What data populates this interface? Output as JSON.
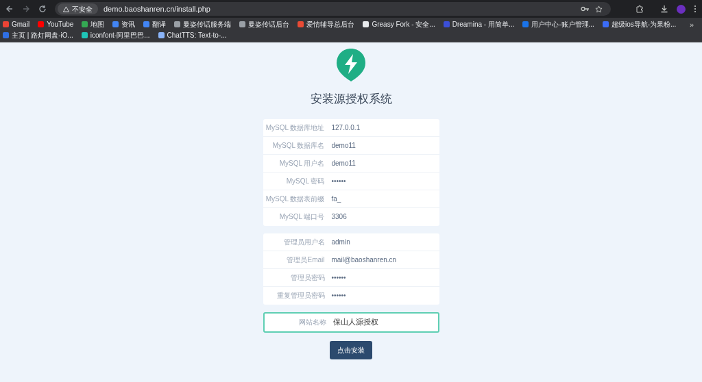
{
  "browser": {
    "security_label": "不安全",
    "url": "demo.baoshanren.cn/install.php",
    "overflow": "»",
    "bookmarks": [
      {
        "label": "Gmail",
        "color": "#ea4335"
      },
      {
        "label": "YouTube",
        "color": "#ff0000"
      },
      {
        "label": "地图",
        "color": "#34a853"
      },
      {
        "label": "资讯",
        "color": "#4285f4"
      },
      {
        "label": "翻译",
        "color": "#4285f4"
      },
      {
        "label": "曼姿传话服务端",
        "color": "#9aa0a6"
      },
      {
        "label": "曼姿传话后台",
        "color": "#9aa0a6"
      },
      {
        "label": "爱情辅导总后台",
        "color": "#e94b35"
      },
      {
        "label": "Greasy Fork - 安全...",
        "color": "#e8eaed"
      },
      {
        "label": "Dreamina - 用简单...",
        "color": "#3b4fd8"
      },
      {
        "label": "用户中心-账户管理...",
        "color": "#1a73e8"
      },
      {
        "label": "超级ios导航-为果粉...",
        "color": "#3b6cf6"
      },
      {
        "label": "主页 | 路灯网盘-iO...",
        "color": "#2f6fe4"
      },
      {
        "label": "iconfont-阿里巴巴...",
        "color": "#1fc5b8"
      },
      {
        "label": "ChatTTS: Text-to-...",
        "color": "#8ab4f8"
      }
    ]
  },
  "page": {
    "title": "安装源授权系统",
    "sections": [
      {
        "fields": [
          {
            "label": "MySQL 数据库地址",
            "value": "127.0.0.1"
          },
          {
            "label": "MySQL 数据库名",
            "value": "demo11"
          },
          {
            "label": "MySQL 用户名",
            "value": "demo11"
          },
          {
            "label": "MySQL 密码",
            "value": "••••••"
          },
          {
            "label": "MySQL 数据表前缀",
            "value": "fa_"
          },
          {
            "label": "MySQL 端口号",
            "value": "3306"
          }
        ]
      },
      {
        "fields": [
          {
            "label": "管理员用户名",
            "value": "admin"
          },
          {
            "label": "管理员Email",
            "value": "mail@baoshanren.cn"
          },
          {
            "label": "管理员密码",
            "value": "••••••"
          },
          {
            "label": "重复管理员密码",
            "value": "••••••"
          }
        ]
      }
    ],
    "site_field": {
      "label": "网站名称",
      "value": "保山人源授权",
      "focused": true
    },
    "install_button": "点击安装"
  }
}
